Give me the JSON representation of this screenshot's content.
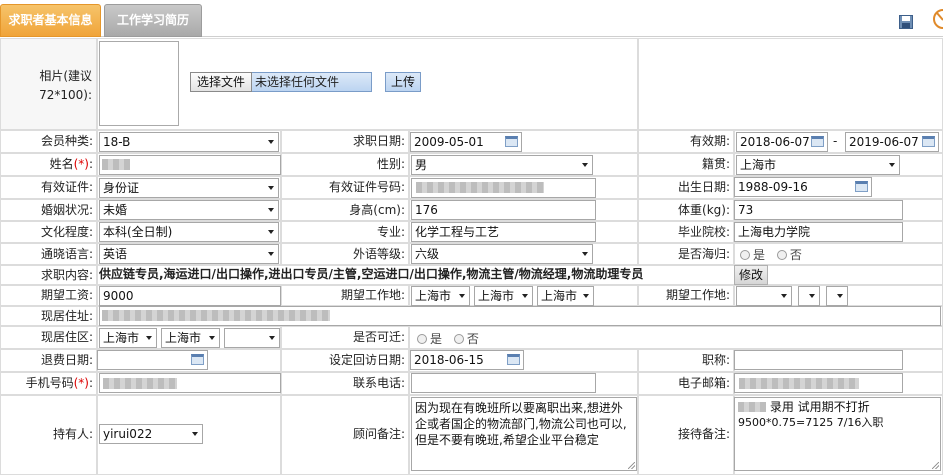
{
  "tabs": [
    {
      "label": "求职者基本信息"
    },
    {
      "label": "工作学习简历"
    }
  ],
  "photo": {
    "label": "相片(建议72*100):",
    "choose_file_label": "选择文件",
    "no_file_label": "未选择任何文件",
    "upload_label": "上传"
  },
  "labels": {
    "member_type": "会员种类:",
    "apply_date": "求职日期:",
    "valid_period": "有效期:",
    "name": "姓名",
    "gender": "性别:",
    "native_place": "籍贯:",
    "id_type": "有效证件:",
    "id_number": "有效证件号码:",
    "birth_date": "出生日期:",
    "marital": "婚姻状况:",
    "height": "身高(cm):",
    "weight": "体重(kg):",
    "education": "文化程度:",
    "major": "专业:",
    "school": "毕业院校:",
    "language": "通晓语言:",
    "foreign_level": "外语等级:",
    "returnee": "是否海归:",
    "job_content": "求职内容:",
    "expected_salary": "期望工资:",
    "expected_location": "期望工作地:",
    "expected_location2": "期望工作地:",
    "address": "现居住址:",
    "district": "现居住区:",
    "relocate": "是否可迁:",
    "refund_date": "退费日期:",
    "revisit_date": "设定回访日期:",
    "title": "职称:",
    "mobile": "手机号码",
    "phone": "联系电话:",
    "email": "电子邮箱:",
    "holder": "持有人:",
    "consultant_note": "顾问备注:",
    "reception_note": "接待备注:"
  },
  "required_mark": "(*)",
  "required_suffix": ":",
  "values": {
    "member_type": "18-B",
    "apply_date": "2009-05-01",
    "valid_from": "2018-06-07",
    "valid_sep": "-",
    "valid_to": "2019-06-07",
    "gender": "男",
    "native_place": "上海市",
    "id_type": "身份证",
    "birth_date": "1988-09-16",
    "marital": "未婚",
    "height": "176",
    "weight": "73",
    "education": "本科(全日制)",
    "major": "化学工程与工艺",
    "school": "上海电力学院",
    "language": "英语",
    "foreign_level": "六级",
    "radio_yes": "是",
    "radio_no": "否",
    "job_content": "供应链专员,海运进口/出口操作,进出口专员/主管,空运进口/出口操作,物流主管/物流经理,物流助理专员",
    "modify_label": "修改",
    "expected_salary": "9000",
    "loc1": "上海市",
    "loc2": "上海市",
    "loc3": "上海市",
    "district1": "上海市",
    "district2": "上海市",
    "revisit_date": "2018-06-15",
    "holder": "yirui022",
    "consultant_note": "因为现在有晚班所以要离职出来,想进外企或者国企的物流部门,物流公司也可以,但是不要有晚班,希望企业平台稳定",
    "reception_note_line1": "录用 试用期不打折",
    "reception_note_line2": "9500*0.75=7125 7/16入职"
  }
}
